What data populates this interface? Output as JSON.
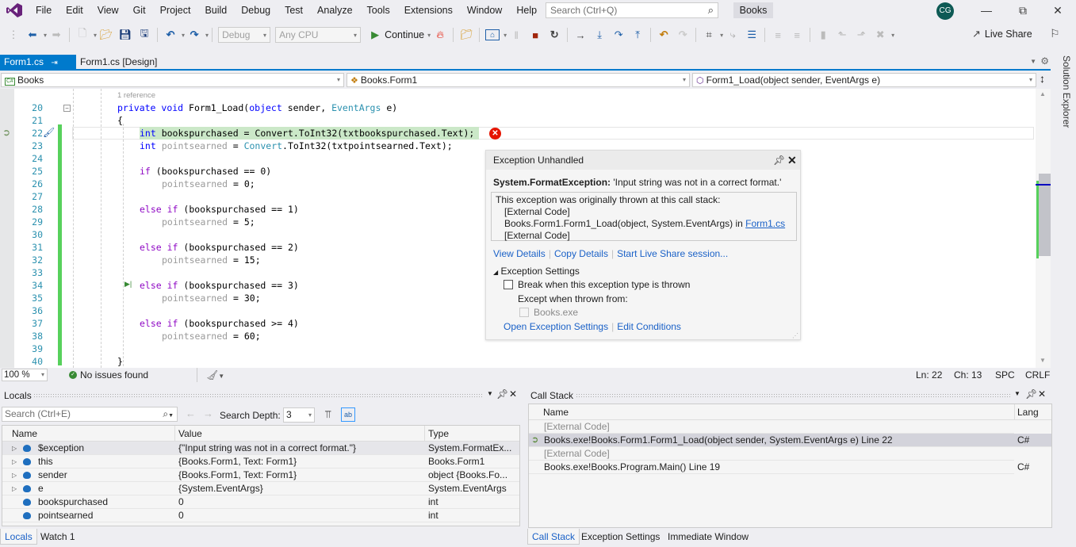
{
  "menu": {
    "items": [
      "File",
      "Edit",
      "View",
      "Git",
      "Project",
      "Build",
      "Debug",
      "Test",
      "Analyze",
      "Tools",
      "Extensions",
      "Window",
      "Help"
    ],
    "search_placeholder": "Search (Ctrl+Q)",
    "solution_name": "Books",
    "user_initials": "CG"
  },
  "toolbar": {
    "config": "Debug",
    "platform": "Any CPU",
    "continue_label": "Continue",
    "live_share_label": "Live Share"
  },
  "doc_tabs": [
    {
      "label": "Form1.cs",
      "active": true
    },
    {
      "label": "Form1.cs [Design]",
      "active": false
    }
  ],
  "navbar": {
    "project": "Books",
    "class": "Books.Form1",
    "member": "Form1_Load(object sender, EventArgs e)"
  },
  "editor": {
    "codelens": "1 reference",
    "lines": [
      {
        "n": "20"
      },
      {
        "n": "21"
      },
      {
        "n": "22"
      },
      {
        "n": "23"
      },
      {
        "n": "24"
      },
      {
        "n": "25"
      },
      {
        "n": "26"
      },
      {
        "n": "27"
      },
      {
        "n": "28"
      },
      {
        "n": "29"
      },
      {
        "n": "30"
      },
      {
        "n": "31"
      },
      {
        "n": "32"
      },
      {
        "n": "33"
      },
      {
        "n": "34"
      },
      {
        "n": "35"
      },
      {
        "n": "36"
      },
      {
        "n": "37"
      },
      {
        "n": "38"
      },
      {
        "n": "39"
      },
      {
        "n": "40"
      }
    ],
    "code": {
      "l20a": "private",
      "l20b": "void",
      "l20c": "Form1_Load(",
      "l20d": "object",
      "l20e": " sender, ",
      "l20f": "EventArgs",
      "l20g": " e)",
      "l21": "{",
      "l22a": "int",
      "l22b": " bookspurchased = ",
      "l22c": "Convert",
      "l22d": ".ToInt32(txtbookspurchased.Text);",
      "l23a": "int",
      "l23b": " pointsearned",
      "l23c": " = ",
      "l23d": "Convert",
      "l23e": ".ToInt32(txtpointsearned.Text);",
      "l25a": "if",
      "l25b": " (bookspurchased == 0)",
      "l26a": "pointsearned",
      "l26b": " = 0;",
      "l28a": "else if",
      "l28b": " (bookspurchased == 1)",
      "l29a": "pointsearned",
      "l29b": " = 5;",
      "l31a": "else if",
      "l31b": " (bookspurchased == 2)",
      "l32a": "pointsearned",
      "l32b": " = 15;",
      "l34a": "else if",
      "l34b": " (bookspurchased == 3)",
      "l35a": "pointsearned",
      "l35b": " = 30;",
      "l37a": "else if",
      "l37b": " (bookspurchased >= 4)",
      "l38a": "pointsearned",
      "l38b": " = 60;",
      "l40": "}"
    }
  },
  "exception": {
    "title": "Exception Unhandled",
    "type": "System.FormatException:",
    "message": " 'Input string was not in a correct format.'",
    "stack_intro": "This exception was originally thrown at this call stack:",
    "stack": [
      "[External Code]",
      "Books.Form1.Form1_Load(object, System.EventArgs) in ",
      "[External Code]"
    ],
    "stack_link": "Form1.cs",
    "links": [
      "View Details",
      "Copy Details",
      "Start Live Share session..."
    ],
    "settings_header": "Exception Settings",
    "break_label": "Break when this exception type is thrown",
    "except_label": "Except when thrown from:",
    "module_label": "Books.exe",
    "bottom_links": [
      "Open Exception Settings",
      "Edit Conditions"
    ]
  },
  "status": {
    "zoom": "100 %",
    "issues": "No issues found",
    "ln": "Ln: 22",
    "ch": "Ch: 13",
    "spc": "SPC",
    "crlf": "CRLF"
  },
  "side_tab": "Solution Explorer",
  "locals": {
    "title": "Locals",
    "search_placeholder": "Search (Ctrl+E)",
    "search_depth_label": "Search Depth:",
    "search_depth": "3",
    "columns": [
      "Name",
      "Value",
      "Type"
    ],
    "rows": [
      {
        "name": "$exception",
        "value": "{\"Input string was not in a correct format.\"}",
        "type": "System.FormatEx...",
        "expandable": true
      },
      {
        "name": "this",
        "value": "{Books.Form1, Text: Form1}",
        "type": "Books.Form1",
        "expandable": true
      },
      {
        "name": "sender",
        "value": "{Books.Form1, Text: Form1}",
        "type": "object {Books.Fo...",
        "expandable": true
      },
      {
        "name": "e",
        "value": "{System.EventArgs}",
        "type": "System.EventArgs",
        "expandable": true
      },
      {
        "name": "bookspurchased",
        "value": "0",
        "type": "int",
        "expandable": false
      },
      {
        "name": "pointsearned",
        "value": "0",
        "type": "int",
        "expandable": false
      }
    ],
    "tabs": [
      "Locals",
      "Watch 1"
    ]
  },
  "callstack": {
    "title": "Call Stack",
    "columns": [
      "Name",
      "Lang"
    ],
    "rows": [
      {
        "name": "[External Code]",
        "lang": "",
        "external": true
      },
      {
        "name": "Books.exe!Books.Form1.Form1_Load(object sender, System.EventArgs e) Line 22",
        "lang": "C#",
        "current": true
      },
      {
        "name": "[External Code]",
        "lang": "",
        "external": true
      },
      {
        "name": "Books.exe!Books.Program.Main() Line 19",
        "lang": "C#"
      }
    ],
    "tabs": [
      "Call Stack",
      "Exception Settings",
      "Immediate Window"
    ]
  },
  "colors": {
    "accent": "#007acc",
    "error": "#e51400",
    "changed_bar": "#57d15c",
    "link": "#1a61c7"
  }
}
